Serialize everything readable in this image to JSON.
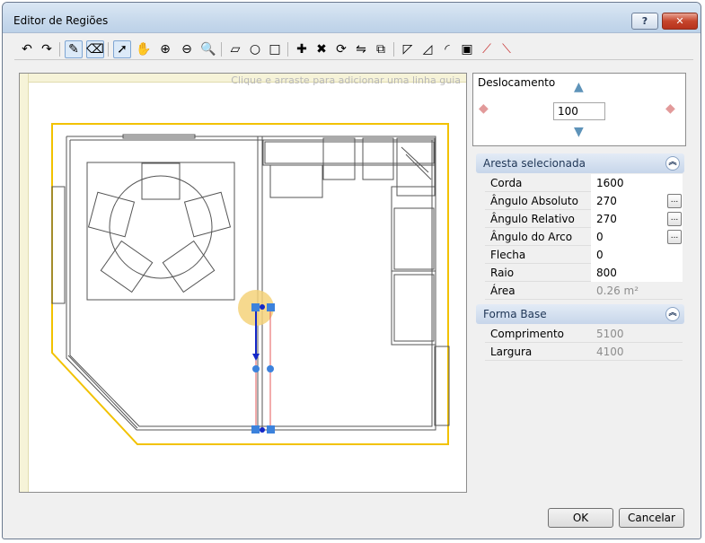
{
  "window": {
    "title": "Editor de Regiões"
  },
  "titlebar": {
    "help_label": "?",
    "close_label": "✕"
  },
  "toolbar": {
    "tools": [
      {
        "name": "undo-icon",
        "glyph": "↶"
      },
      {
        "name": "redo-icon",
        "glyph": "↷"
      },
      {
        "name": "edit-region-icon",
        "glyph": "✎"
      },
      {
        "name": "delete-region-icon",
        "glyph": "⌫"
      },
      {
        "name": "pointer-icon",
        "glyph": "➚"
      },
      {
        "name": "pan-icon",
        "glyph": "✋"
      },
      {
        "name": "zoom-in-icon",
        "glyph": "⊕"
      },
      {
        "name": "zoom-out-icon",
        "glyph": "⊖"
      },
      {
        "name": "zoom-fit-icon",
        "glyph": "🔍"
      },
      {
        "name": "polygon-tool-icon",
        "glyph": "▱"
      },
      {
        "name": "circle-tool-icon",
        "glyph": "○"
      },
      {
        "name": "rectangle-tool-icon",
        "glyph": "□"
      },
      {
        "name": "add-point-icon",
        "glyph": "✚"
      },
      {
        "name": "remove-point-icon",
        "glyph": "✖"
      },
      {
        "name": "rotate-region-icon",
        "glyph": "⟳"
      },
      {
        "name": "mirror-region-icon",
        "glyph": "⇋"
      },
      {
        "name": "offset-region-icon",
        "glyph": "⧉"
      },
      {
        "name": "cut-corner-icon",
        "glyph": "◸"
      },
      {
        "name": "chamfer-icon",
        "glyph": "◿"
      },
      {
        "name": "round-corner-icon",
        "glyph": "◜"
      },
      {
        "name": "square-region-icon",
        "glyph": "▣"
      },
      {
        "name": "trim-red-icon",
        "glyph": "⟋"
      },
      {
        "name": "arc-red-icon",
        "glyph": "⟍"
      }
    ]
  },
  "canvas": {
    "guide_hint": "Clique e arraste para adicionar uma linha guia"
  },
  "displacement": {
    "title": "Deslocamento",
    "value": "100",
    "up_glyph": "▲",
    "down_glyph": "▼",
    "left_glyph": "◆",
    "right_glyph": "◆"
  },
  "selected_edge": {
    "header": "Aresta selecionada",
    "collapse_glyph": "︽",
    "rows": [
      {
        "label": "Corda",
        "value": "1600"
      },
      {
        "label": "Ângulo Absoluto",
        "value": "270",
        "button": "..."
      },
      {
        "label": "Ângulo Relativo",
        "value": "270",
        "button": "..."
      },
      {
        "label": "Ângulo do Arco",
        "value": "0",
        "button": "..."
      },
      {
        "label": "Flecha",
        "value": "0"
      },
      {
        "label": "Raio",
        "value": "800"
      },
      {
        "label": "Área",
        "value": "0.26 m²"
      }
    ]
  },
  "base_shape": {
    "header": "Forma Base",
    "collapse_glyph": "︽",
    "rows": [
      {
        "label": "Comprimento",
        "value": "5100"
      },
      {
        "label": "Largura",
        "value": "4100"
      }
    ]
  },
  "footer": {
    "ok_label": "OK",
    "cancel_label": "Cancelar"
  },
  "colors": {
    "region_outline": "#f2c200",
    "selected_edge": "#1428c8",
    "guide_lines": "#e65a5a",
    "handle": "#3c82dc",
    "highlight": "#f5d27a"
  }
}
